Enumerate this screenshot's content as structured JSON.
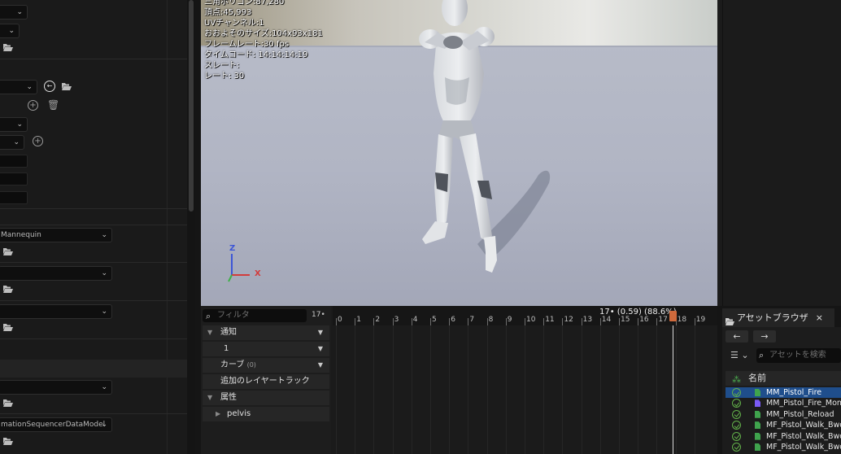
{
  "details": {
    "combos": [
      {
        "label": "",
        "top": 0
      },
      {
        "label": "",
        "top": 0
      },
      {
        "label": "",
        "top": 0
      }
    ],
    "skeleton_label": "Mannequin",
    "datamodel_label": "mationSequencerDataModel"
  },
  "viewport": {
    "stats": [
      "三角ポリゴン:87,280",
      "頂点:45,993",
      "UVチャンネル:1",
      "おおよそのサイズ:104x93x181",
      "フレームレート:30 fps",
      "タイムコード: 14:14:14:19",
      "スレート:",
      "レート: 30"
    ],
    "axis_z": "Z",
    "axis_x": "X"
  },
  "timeline": {
    "filter_placeholder": "フィルタ",
    "frame_count": "17•",
    "tracks": [
      {
        "label": "通知",
        "expand": "▼",
        "dropdown": true
      },
      {
        "label": "1",
        "expand": "",
        "dropdown": true
      },
      {
        "label": "カーブ",
        "count": "(0)",
        "expand": "",
        "dropdown": true
      },
      {
        "label": "追加のレイヤートラック",
        "expand": "",
        "dropdown": false
      },
      {
        "label": "属性",
        "expand": "▼",
        "dropdown": false
      },
      {
        "label": "pelvis",
        "expand": "▶",
        "dropdown": false
      }
    ],
    "ticks": [
      "0",
      "1",
      "2",
      "3",
      "4",
      "5",
      "6",
      "7",
      "8",
      "9",
      "10",
      "11",
      "12",
      "13",
      "14",
      "15",
      "16",
      "17",
      "18",
      "19"
    ],
    "position_info": "17• (0.59) (88.6%)"
  },
  "assets": {
    "tab_label": "アセットブラウザ",
    "close": "×",
    "back": "🡐",
    "forward": "🡒",
    "search_placeholder": "アセットを検索",
    "column_name": "名前",
    "items": [
      {
        "name": "MM_Pistol_Fire",
        "selected": true,
        "type": "sequence"
      },
      {
        "name": "MM_Pistol_Fire_Mon",
        "selected": false,
        "type": "montage"
      },
      {
        "name": "MM_Pistol_Reload",
        "selected": false,
        "type": "sequence"
      },
      {
        "name": "MF_Pistol_Walk_Bwd",
        "selected": false,
        "type": "sequence"
      },
      {
        "name": "MF_Pistol_Walk_Bwd",
        "selected": false,
        "type": "sequence"
      },
      {
        "name": "MF_Pistol_Walk_Bwd",
        "selected": false,
        "type": "sequence"
      }
    ]
  },
  "colors": {
    "accent": "#1f4e8c",
    "playhead_handle": "#d06a3c",
    "check": "#63b24a"
  }
}
